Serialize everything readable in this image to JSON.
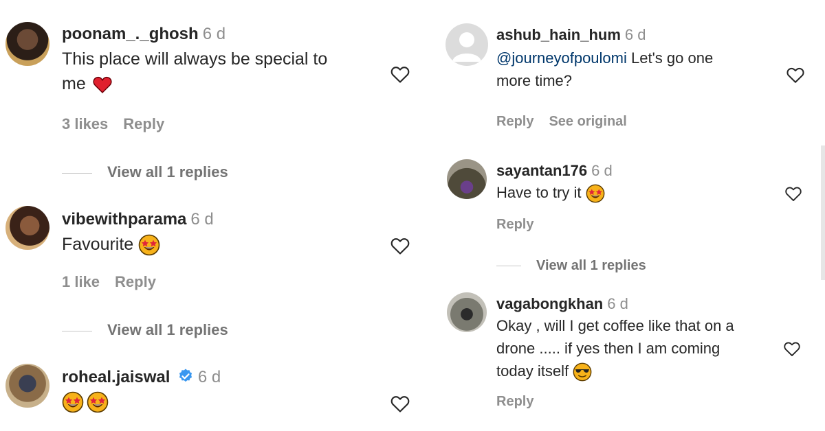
{
  "left": [
    {
      "user": "poonam_._ghosh",
      "time": "6 d",
      "text": "This place will always be special to",
      "text2": "me",
      "likes": "3 likes",
      "reply": "Reply",
      "view_replies": "View all 1 replies"
    },
    {
      "user": "vibewithparama",
      "time": "6 d",
      "text": "Favourite",
      "likes": "1 like",
      "reply": "Reply",
      "view_replies": "View all 1 replies"
    },
    {
      "user": "roheal.jaiswal",
      "time": "6 d",
      "verified": true
    }
  ],
  "right": [
    {
      "user": "ashub_hain_hum",
      "time": "6 d",
      "mention": "@journeyofpoulomi",
      "text": " Let's go one",
      "text2": "more time?",
      "reply": "Reply",
      "see_original": "See original"
    },
    {
      "user": "sayantan176",
      "time": "6 d",
      "text": "Have to try it",
      "reply": "Reply",
      "view_replies": "View all 1 replies"
    },
    {
      "user": "vagabongkhan",
      "time": "6 d",
      "text": "Okay , will I get coffee like that on a",
      "text2": "drone ..... if yes then I am coming",
      "text3": "today itself",
      "reply": "Reply"
    }
  ],
  "icons": {
    "like": "heart-outline-icon",
    "verified": "verified-badge-icon",
    "heart_emoji": "red-heart-emoji",
    "star_eyes": "star-struck-emoji",
    "sunglasses": "sunglasses-emoji"
  },
  "colors": {
    "mention": "#00376b",
    "verified": "#3897f0",
    "meta": "#8e8e8e"
  }
}
